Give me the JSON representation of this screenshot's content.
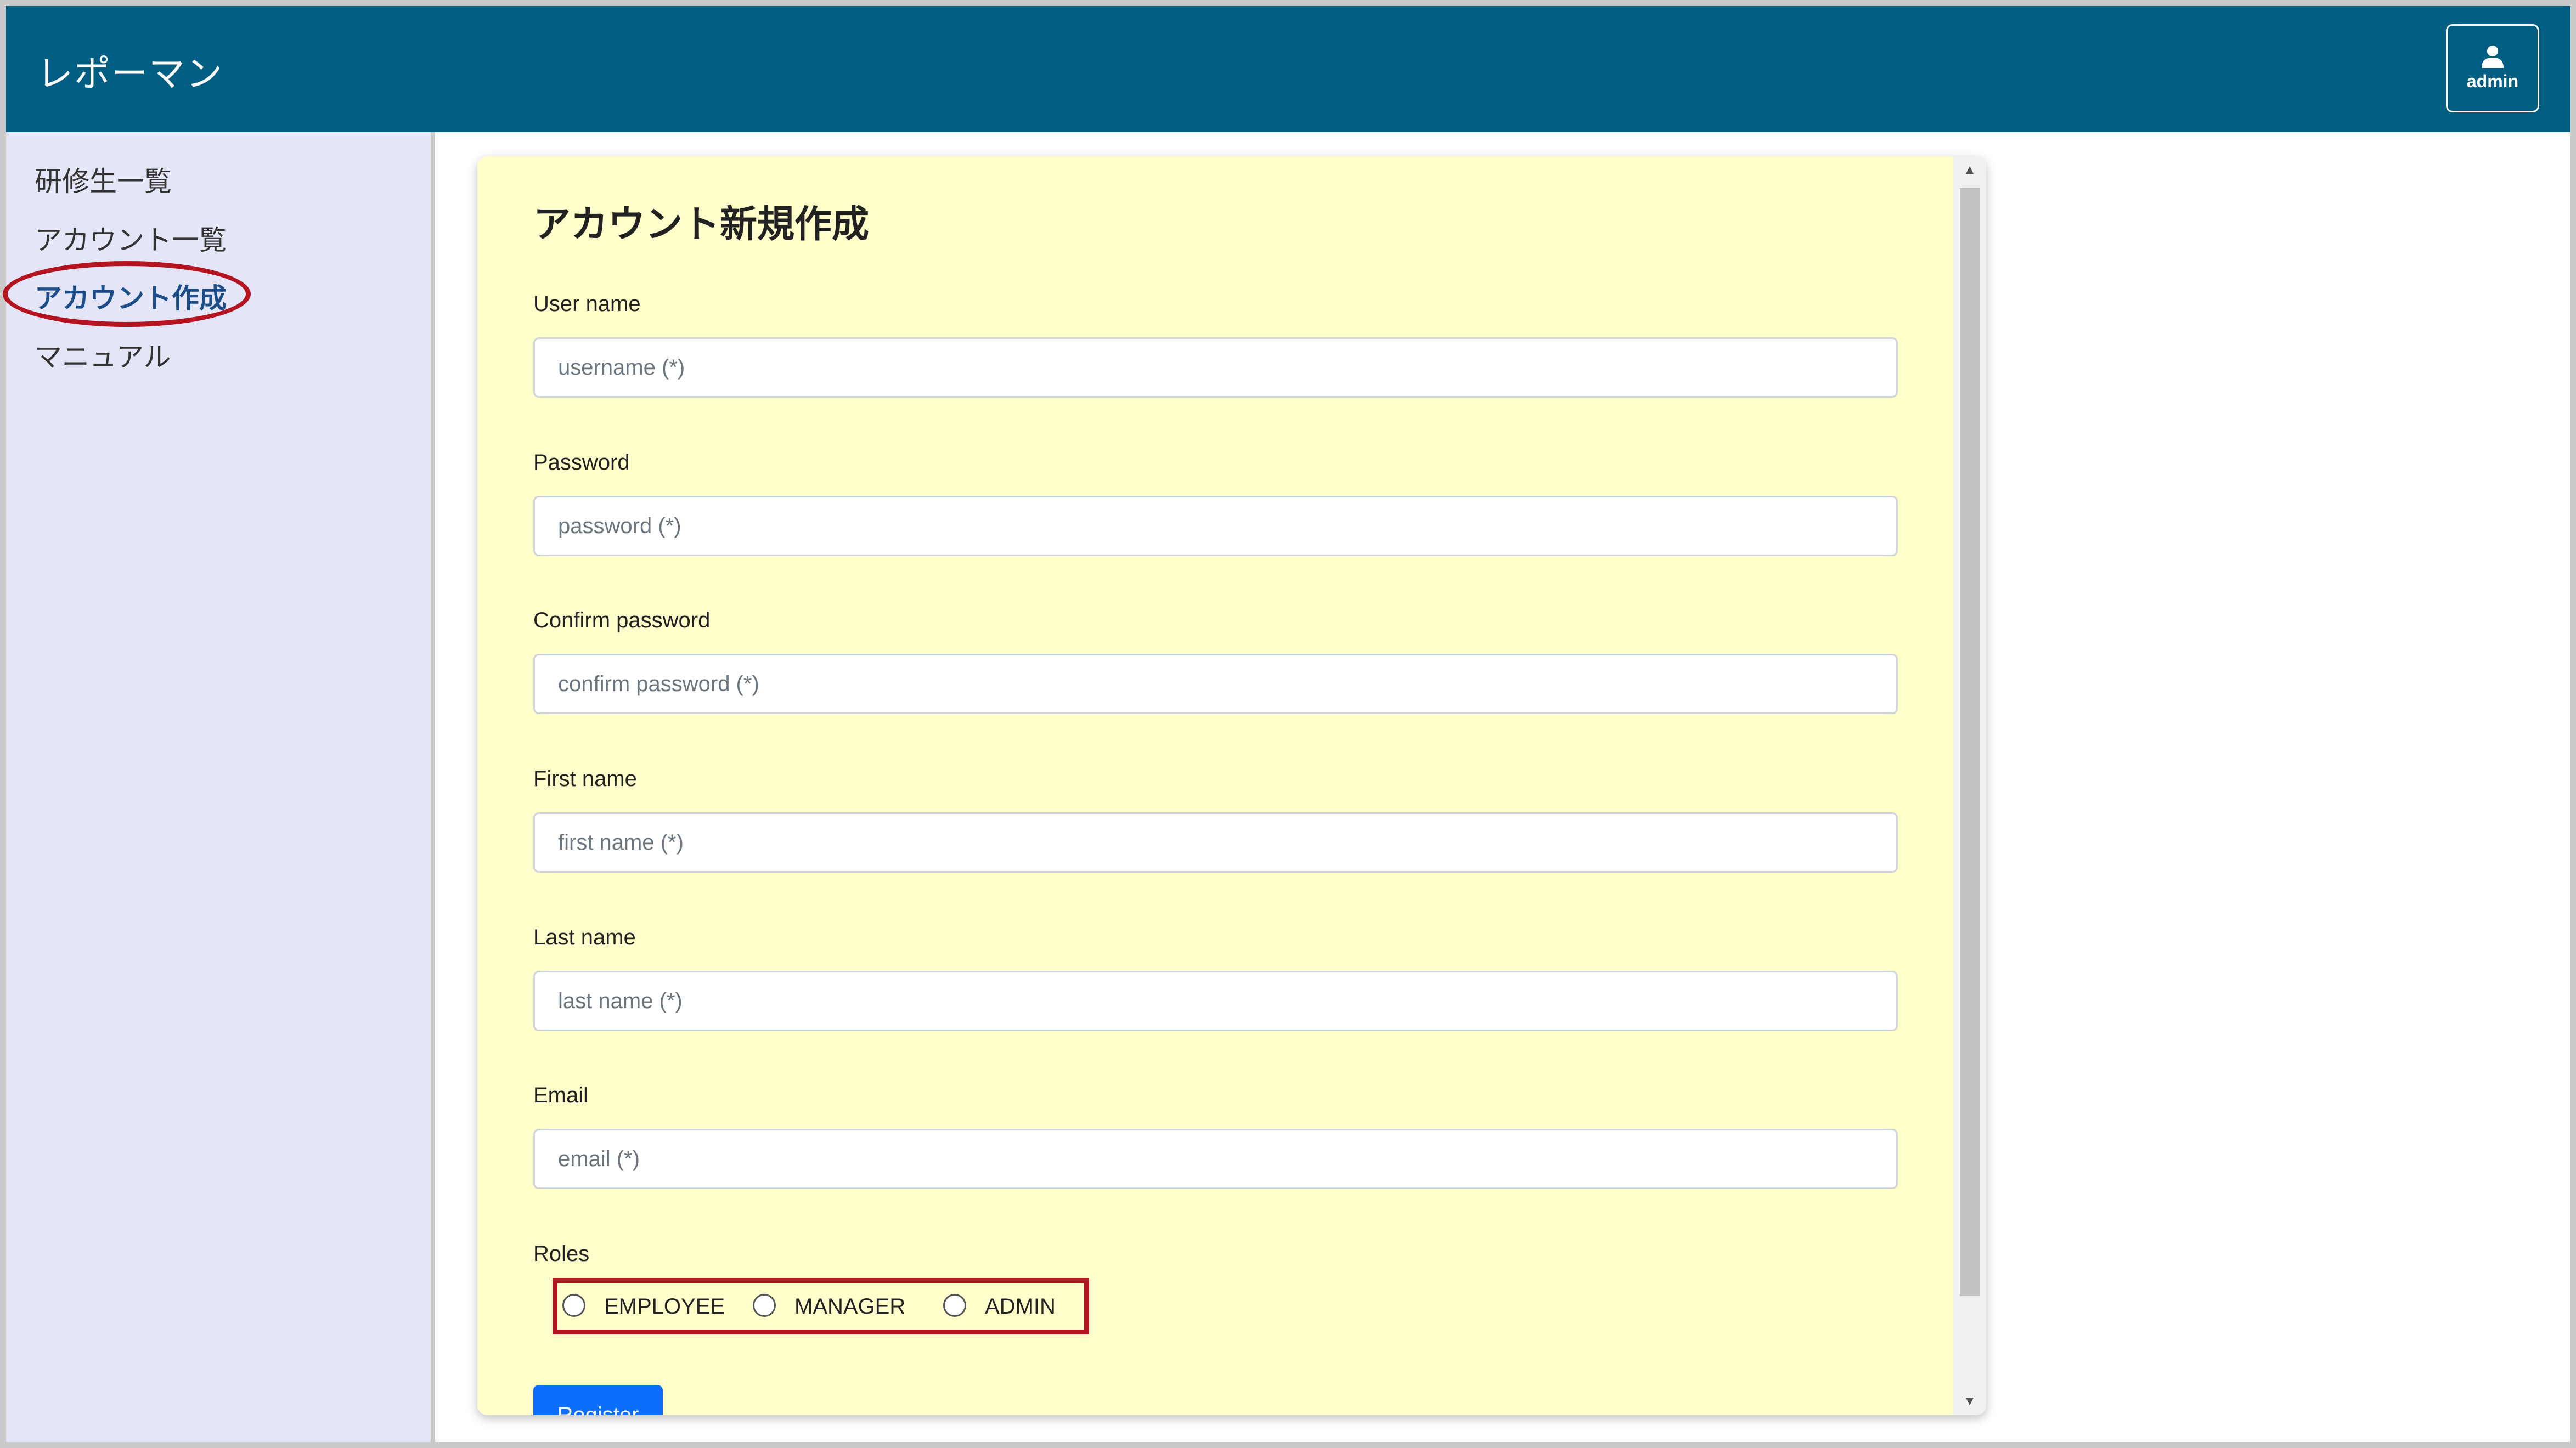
{
  "app": {
    "title": "レポーマン"
  },
  "user_menu": {
    "label": "admin",
    "icon": "user-icon"
  },
  "sidebar": {
    "items": [
      {
        "label": "研修生一覧",
        "active": false
      },
      {
        "label": "アカウント一覧",
        "active": false
      },
      {
        "label": "アカウント作成",
        "active": true
      },
      {
        "label": "マニュアル",
        "active": false
      }
    ]
  },
  "form": {
    "title": "アカウント新規作成",
    "fields": [
      {
        "label": "User name",
        "placeholder": "username (*)"
      },
      {
        "label": "Password",
        "placeholder": "password (*)"
      },
      {
        "label": "Confirm password",
        "placeholder": "confirm password (*)"
      },
      {
        "label": "First name",
        "placeholder": "first name (*)"
      },
      {
        "label": "Last name",
        "placeholder": "last name (*)"
      },
      {
        "label": "Email",
        "placeholder": "email (*)"
      }
    ],
    "roles_label": "Roles",
    "roles": [
      "EMPLOYEE",
      "MANAGER",
      "ADMIN"
    ],
    "submit_label": "Register"
  },
  "colors": {
    "header": "#005e83",
    "sidebar": "#e5e5f8",
    "card": "#ffffcc",
    "annotation": "#b3141f",
    "primary_button": "#0d6efd"
  }
}
